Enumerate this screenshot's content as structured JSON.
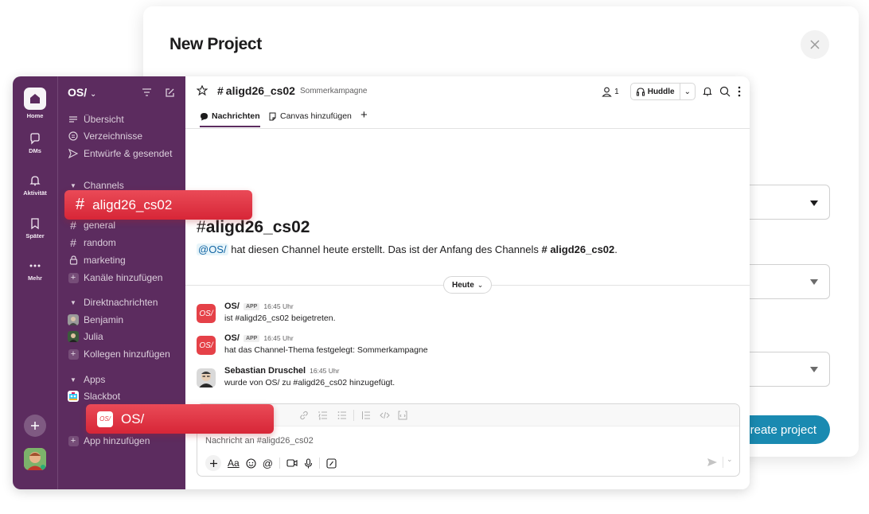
{
  "modal": {
    "title": "New Project",
    "create_button": "Create project"
  },
  "rail": {
    "items": [
      {
        "label": "Home",
        "icon": "home-icon"
      },
      {
        "label": "DMs",
        "icon": "chat-bubble-icon"
      },
      {
        "label": "Aktivität",
        "icon": "bell-icon"
      },
      {
        "label": "Später",
        "icon": "bookmark-icon"
      },
      {
        "label": "Mehr",
        "icon": "more-dots-icon"
      }
    ]
  },
  "sidebar": {
    "workspace": "OS/",
    "nav": [
      "Übersicht",
      "Verzeichnisse",
      "Entwürfe & gesendet"
    ],
    "channels_header": "Channels",
    "channels": [
      "general",
      "random",
      "marketing"
    ],
    "add_channels": "Kanäle hinzufügen",
    "dm_header": "Direktnachrichten",
    "dms": [
      "Benjamin",
      "Julia"
    ],
    "add_colleagues": "Kollegen hinzufügen",
    "apps_header": "Apps",
    "apps": [
      "Slackbot"
    ],
    "add_app": "App hinzufügen"
  },
  "header": {
    "channel": "aligd26_cs02",
    "topic": "Sommerkampagne",
    "member_count": "1",
    "huddle": "Huddle"
  },
  "tabs": {
    "messages": "Nachrichten",
    "canvas": "Canvas hinzufügen"
  },
  "intro": {
    "channel": "aligd26_cs02",
    "mention": "@OS/",
    "text": "hat diesen Channel heute erstellt. Das ist der Anfang des Channels",
    "channel_ref": "# aligd26_cs02",
    "period": "."
  },
  "day": "Heute",
  "messages": [
    {
      "author": "OS/",
      "badge": "APP",
      "time": "16:45 Uhr",
      "text": "ist #aligd26_cs02 beigetreten."
    },
    {
      "author": "OS/",
      "badge": "APP",
      "time": "16:45 Uhr",
      "text": "hat das Channel-Thema festgelegt: Sommerkampagne"
    },
    {
      "author": "Sebastian Druschel",
      "badge": "",
      "time": "16:45 Uhr",
      "text": "wurde von OS/ zu #aligd26_cs02 hinzugefügt."
    }
  ],
  "composer": {
    "placeholder": "Nachricht an #aligd26_cs02",
    "aa": "Aa"
  },
  "tags": {
    "channel_tag": "aligd26_cs02",
    "app_tag": "OS/"
  },
  "colors": {
    "aubergine": "#5c2c5f",
    "tag_red": "#e03a47",
    "create_blue": "#1a8ab1"
  }
}
